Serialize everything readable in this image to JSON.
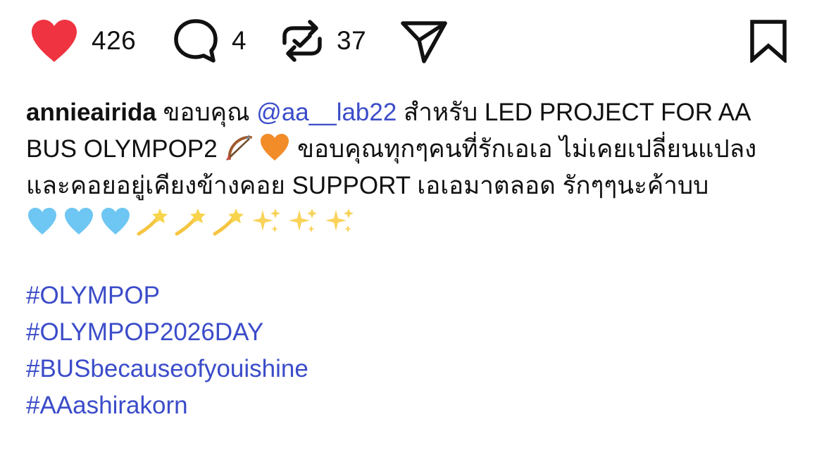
{
  "actions": {
    "like_count": "426",
    "comment_count": "4",
    "repost_count": "37",
    "icons": [
      "heart-icon",
      "comment-icon",
      "repost-icon",
      "share-icon",
      "bookmark-icon"
    ],
    "like_color": "#ef3340"
  },
  "caption": {
    "username": "annieairida",
    "text_1": " ขอบคุณ ",
    "mention": "@aa__lab22",
    "text_2": " สำหรับ LED PROJECT FOR AA BUS OLYMPOP2 ",
    "emojis_1": [
      "bow-and-arrow",
      "orange-heart"
    ],
    "text_3": " ขอบคุณทุกๆคนที่รักเอเอ ไม่เคยเปลี่ยนแปลง และคอยอยู่เคียงข้างคอย SUPPORT เอเอมาตลอด รักๆๆนะค้าบบ ",
    "emojis_2": [
      "light-blue-heart",
      "light-blue-heart",
      "light-blue-heart",
      "dizzy",
      "dizzy",
      "dizzy",
      "sparkles",
      "sparkles",
      "sparkles"
    ],
    "link_color": "#3b4cc9"
  },
  "hashtags": [
    "#OLYMPOP",
    "#OLYMPOP2026DAY",
    "#BUSbecauseofyouishine",
    "#AAashirakorn"
  ]
}
